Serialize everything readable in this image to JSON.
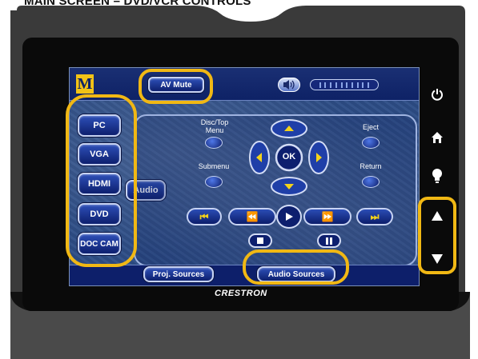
{
  "document": {
    "title": "MAIN SCREEN – DVD/VCR CONTROLS"
  },
  "touchpanel": {
    "top_bar": {
      "logo_letter": "M",
      "av_mute_label": "AV Mute",
      "volume_icon": "speaker-icon"
    },
    "sources": [
      {
        "label": "PC"
      },
      {
        "label": "VGA"
      },
      {
        "label": "HDMI"
      },
      {
        "label": "DVD"
      },
      {
        "label": "DOC CAM"
      }
    ],
    "audio_button_label": "Audio",
    "dvd_panel": {
      "disc_top_menu_label": "Disc/Top\nMenu",
      "eject_label": "Eject",
      "submenu_label": "Submenu",
      "return_label": "Return",
      "ok_label": "OK",
      "transport": [
        "previous-track",
        "rewind",
        "play",
        "fast-forward",
        "next-track",
        "stop",
        "pause"
      ]
    },
    "bottom_bar": {
      "proj_sources_label": "Proj. Sources",
      "audio_sources_label": "Audio Sources"
    }
  },
  "hardware_buttons": [
    "power-icon",
    "home-icon",
    "lightbulb-icon",
    "up-arrow-icon",
    "down-arrow-icon"
  ],
  "brand": "CRESTRON",
  "colors": {
    "highlight": "#f1b814",
    "panel_blue": "#2d4d86",
    "bezel": "#0a0a0a",
    "bar_blue": "#0e2266"
  }
}
